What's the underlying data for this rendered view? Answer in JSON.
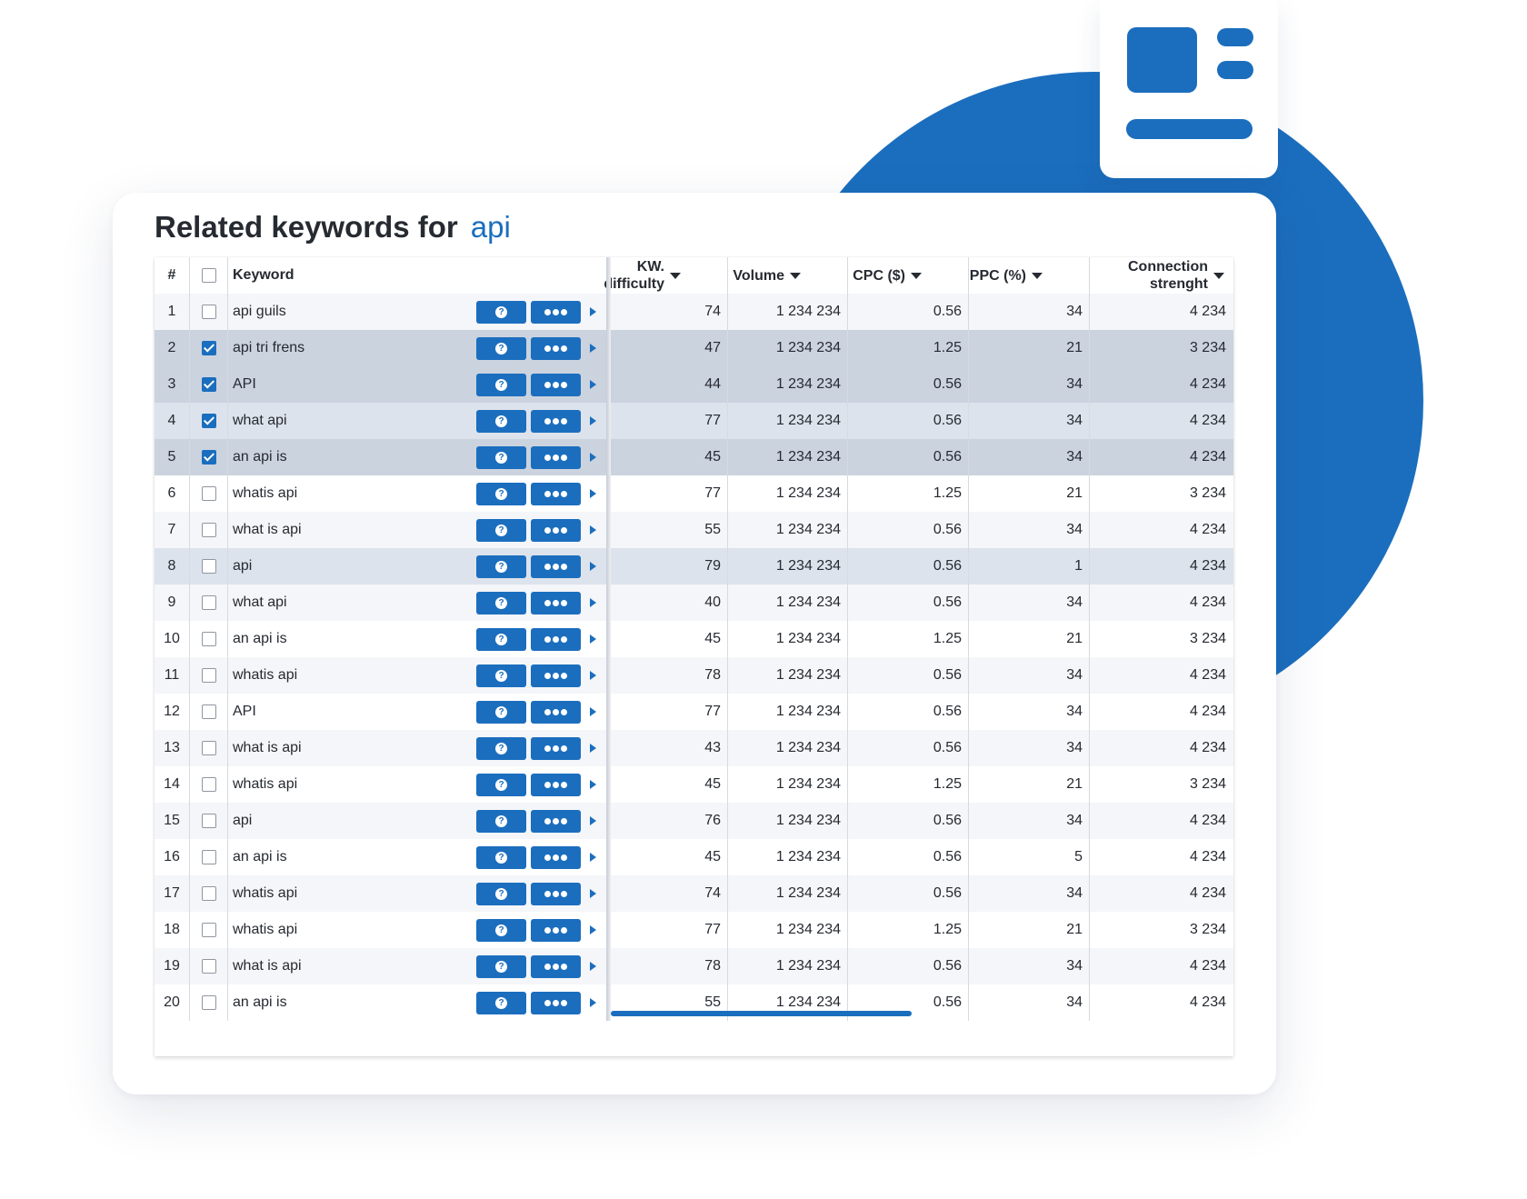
{
  "title": {
    "prefix": "Related keywords for",
    "keyword": "api"
  },
  "colors": {
    "accent": "#1b6ebe",
    "selected_row": "#cbd3df",
    "text": "#262a31"
  },
  "icons": {
    "help_button": "question-icon",
    "more_button": "ellipsis-icon",
    "expand": "play-arrow-icon",
    "sort": "caret-down-icon"
  },
  "table": {
    "headers": {
      "num": "#",
      "keyword": "Keyword",
      "kw_difficulty": "KW. difficulty",
      "volume": "Volume",
      "cpc": "CPC ($)",
      "ppc": "PPC (%)",
      "connection_line1": "Connection",
      "connection_line2": "strenght"
    },
    "rows": [
      {
        "num": "1",
        "checked": false,
        "keyword": "api guils",
        "kw_difficulty": "74",
        "volume": "1 234 234",
        "cpc": "0.56",
        "ppc": "34",
        "connection": "4 234"
      },
      {
        "num": "2",
        "checked": true,
        "keyword": "api tri frens",
        "kw_difficulty": "47",
        "volume": "1 234 234",
        "cpc": "1.25",
        "ppc": "21",
        "connection": "3 234"
      },
      {
        "num": "3",
        "checked": true,
        "keyword": "API",
        "kw_difficulty": "44",
        "volume": "1 234 234",
        "cpc": "0.56",
        "ppc": "34",
        "connection": "4 234"
      },
      {
        "num": "4",
        "checked": true,
        "keyword": "what api",
        "kw_difficulty": "77",
        "volume": "1 234 234",
        "cpc": "0.56",
        "ppc": "34",
        "connection": "4 234"
      },
      {
        "num": "5",
        "checked": true,
        "keyword": "an api is",
        "kw_difficulty": "45",
        "volume": "1 234 234",
        "cpc": "0.56",
        "ppc": "34",
        "connection": "4 234"
      },
      {
        "num": "6",
        "checked": false,
        "keyword": "whatis api",
        "kw_difficulty": "77",
        "volume": "1 234 234",
        "cpc": "1.25",
        "ppc": "21",
        "connection": "3 234"
      },
      {
        "num": "7",
        "checked": false,
        "keyword": "what is api",
        "kw_difficulty": "55",
        "volume": "1 234 234",
        "cpc": "0.56",
        "ppc": "34",
        "connection": "4 234"
      },
      {
        "num": "8",
        "checked": false,
        "keyword": "api",
        "kw_difficulty": "79",
        "volume": "1 234 234",
        "cpc": "0.56",
        "ppc": "1",
        "connection": "4 234"
      },
      {
        "num": "9",
        "checked": false,
        "keyword": "what api",
        "kw_difficulty": "40",
        "volume": "1 234 234",
        "cpc": "0.56",
        "ppc": "34",
        "connection": "4 234"
      },
      {
        "num": "10",
        "checked": false,
        "keyword": "an api is",
        "kw_difficulty": "45",
        "volume": "1 234 234",
        "cpc": "1.25",
        "ppc": "21",
        "connection": "3 234"
      },
      {
        "num": "11",
        "checked": false,
        "keyword": "whatis api",
        "kw_difficulty": "78",
        "volume": "1 234 234",
        "cpc": "0.56",
        "ppc": "34",
        "connection": "4 234"
      },
      {
        "num": "12",
        "checked": false,
        "keyword": "API",
        "kw_difficulty": "77",
        "volume": "1 234 234",
        "cpc": "0.56",
        "ppc": "34",
        "connection": "4 234"
      },
      {
        "num": "13",
        "checked": false,
        "keyword": "what is api",
        "kw_difficulty": "43",
        "volume": "1 234 234",
        "cpc": "0.56",
        "ppc": "34",
        "connection": "4 234"
      },
      {
        "num": "14",
        "checked": false,
        "keyword": "whatis api",
        "kw_difficulty": "45",
        "volume": "1 234 234",
        "cpc": "1.25",
        "ppc": "21",
        "connection": "3 234"
      },
      {
        "num": "15",
        "checked": false,
        "keyword": "api",
        "kw_difficulty": "76",
        "volume": "1 234 234",
        "cpc": "0.56",
        "ppc": "34",
        "connection": "4 234"
      },
      {
        "num": "16",
        "checked": false,
        "keyword": "an api is",
        "kw_difficulty": "45",
        "volume": "1 234 234",
        "cpc": "0.56",
        "ppc": "5",
        "connection": "4 234"
      },
      {
        "num": "17",
        "checked": false,
        "keyword": "whatis api",
        "kw_difficulty": "74",
        "volume": "1 234 234",
        "cpc": "0.56",
        "ppc": "34",
        "connection": "4 234"
      },
      {
        "num": "18",
        "checked": false,
        "keyword": "whatis api",
        "kw_difficulty": "77",
        "volume": "1 234 234",
        "cpc": "1.25",
        "ppc": "21",
        "connection": "3 234"
      },
      {
        "num": "19",
        "checked": false,
        "keyword": "what is api",
        "kw_difficulty": "78",
        "volume": "1 234 234",
        "cpc": "0.56",
        "ppc": "34",
        "connection": "4 234"
      },
      {
        "num": "20",
        "checked": false,
        "keyword": "an api is",
        "kw_difficulty": "55",
        "volume": "1 234 234",
        "cpc": "0.56",
        "ppc": "34",
        "connection": "4 234"
      }
    ]
  }
}
